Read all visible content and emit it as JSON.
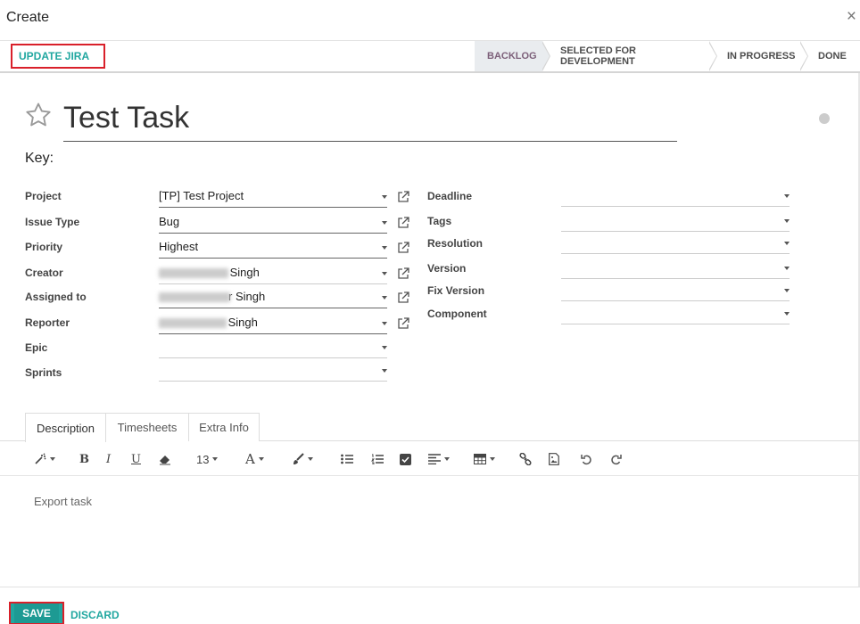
{
  "modal": {
    "title": "Create",
    "close_glyph": "×"
  },
  "statusbar": {
    "update_label": "UPDATE JIRA",
    "stages": [
      "BACKLOG",
      "SELECTED FOR DEVELOPMENT",
      "IN PROGRESS",
      "DONE"
    ],
    "active_stage": "BACKLOG"
  },
  "task": {
    "title": "Test Task",
    "key_label": "Key:"
  },
  "left_fields": [
    {
      "label": "Project",
      "value": "[TP] Test Project"
    },
    {
      "label": "Issue Type",
      "value": "Bug"
    },
    {
      "label": "Priority",
      "value": "Highest"
    },
    {
      "label": "Creator",
      "value": "Singh"
    },
    {
      "label": "Assigned to",
      "value": "r Singh"
    },
    {
      "label": "Reporter",
      "value": "Singh"
    },
    {
      "label": "Epic",
      "value": ""
    },
    {
      "label": "Sprints",
      "value": ""
    }
  ],
  "right_fields": [
    {
      "label": "Deadline",
      "value": ""
    },
    {
      "label": "Tags",
      "value": ""
    },
    {
      "label": "Resolution",
      "value": ""
    },
    {
      "label": "Version",
      "value": ""
    },
    {
      "label": "Fix Version",
      "value": ""
    },
    {
      "label": "Component",
      "value": ""
    }
  ],
  "tabs": [
    "Description",
    "Timesheets",
    "Extra Info"
  ],
  "toolbar": {
    "font_size": "13"
  },
  "editor": {
    "content": "Export task"
  },
  "footer": {
    "save_label": "SAVE",
    "discard_label": "DISCARD"
  },
  "colors": {
    "accent": "#21a7a0",
    "highlight": "#d9202a",
    "active_stage_text": "#7c5f79"
  }
}
